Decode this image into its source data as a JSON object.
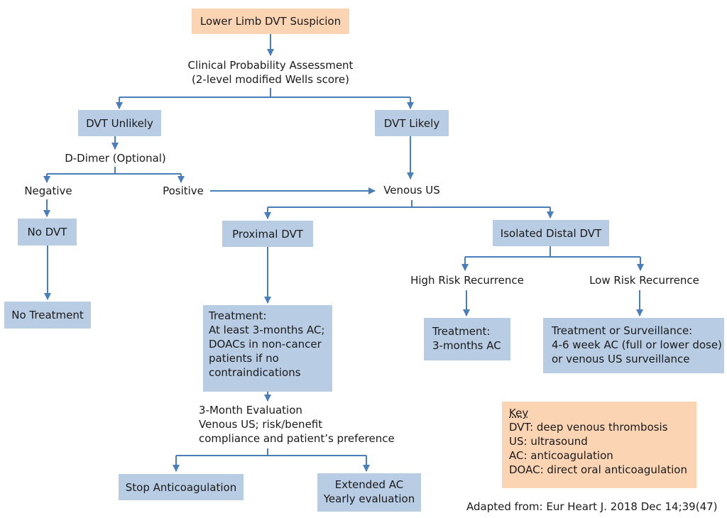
{
  "colors": {
    "arrow": "#4a7ebb",
    "box_blue": "#b8cce4",
    "box_orange": "#fbd4b4",
    "text": "#1a1a1a"
  },
  "nodes": {
    "start": "Lower Limb DVT Suspicion",
    "assessment": [
      "Clinical Probability Assessment",
      "(2-level modified Wells score)"
    ],
    "dvt_unlikely": "DVT Unlikely",
    "dvt_likely": "DVT Likely",
    "d_dimer": "D-Dimer (Optional)",
    "negative": "Negative",
    "positive": "Positive",
    "venous_us": "Venous US",
    "no_dvt": "No DVT",
    "no_treatment": "No Treatment",
    "proximal_dvt": "Proximal DVT",
    "isolated_distal_dvt": "Isolated Distal DVT",
    "high_risk": "High Risk Recurrence",
    "low_risk": "Low Risk Recurrence",
    "proximal_treatment": [
      "Treatment:",
      "At least 3-months AC;",
      "DOACs in non-cancer",
      "patients if no",
      "contraindications"
    ],
    "high_risk_treatment": [
      "Treatment:",
      "3-months AC"
    ],
    "low_risk_treatment": [
      "Treatment or Surveillance:",
      "4-6 week AC (full or lower dose)",
      "or venous US surveillance"
    ],
    "evaluation": [
      "3-Month Evaluation",
      "Venous US; risk/benefit",
      "compliance and patient’s preference"
    ],
    "stop_ac": "Stop Anticoagulation",
    "extended_ac": [
      "Extended AC",
      "Yearly evaluation"
    ]
  },
  "key": {
    "title": "Key",
    "entries": [
      "DVT: deep venous thrombosis",
      "US: ultrasound",
      "AC: anticoagulation",
      "DOAC: direct oral anticoagulation"
    ]
  },
  "source": "Adapted from: Eur Heart J. 2018 Dec 14;39(47)"
}
